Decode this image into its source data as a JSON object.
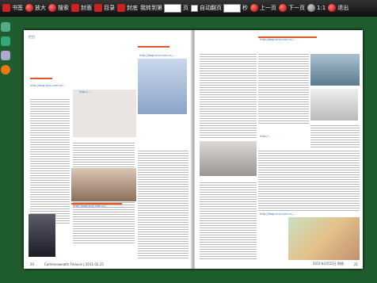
{
  "toolbar": {
    "bookmark": "书签",
    "zoom_in": "放大",
    "search": "搜索",
    "cover": "封面",
    "toc": "目录",
    "back_cover": "封底",
    "jump_prefix": "我转到第",
    "jump_suffix": "页",
    "auto_flip": "自动翻页",
    "seconds": "秒",
    "prev": "上一页",
    "next": "下一页",
    "ratio": "1:1",
    "exit": "退出"
  },
  "left_page": {
    "column_label": "栏目",
    "page_num": "20",
    "footer": "Commonwealth Finance | 2011.02.15",
    "urls": [
      "http://blog.sina.com.cn/...",
      "http://...",
      "http://blog.sina.com.cn/...",
      "http://blog.sina.com.cn/..."
    ]
  },
  "right_page": {
    "page_num": "21",
    "footer": "2011年2月15日 财经",
    "urls": [
      "http://blog.sina.com.cn/...",
      "http://...",
      "http://blog.sina.com.cn/..."
    ]
  }
}
